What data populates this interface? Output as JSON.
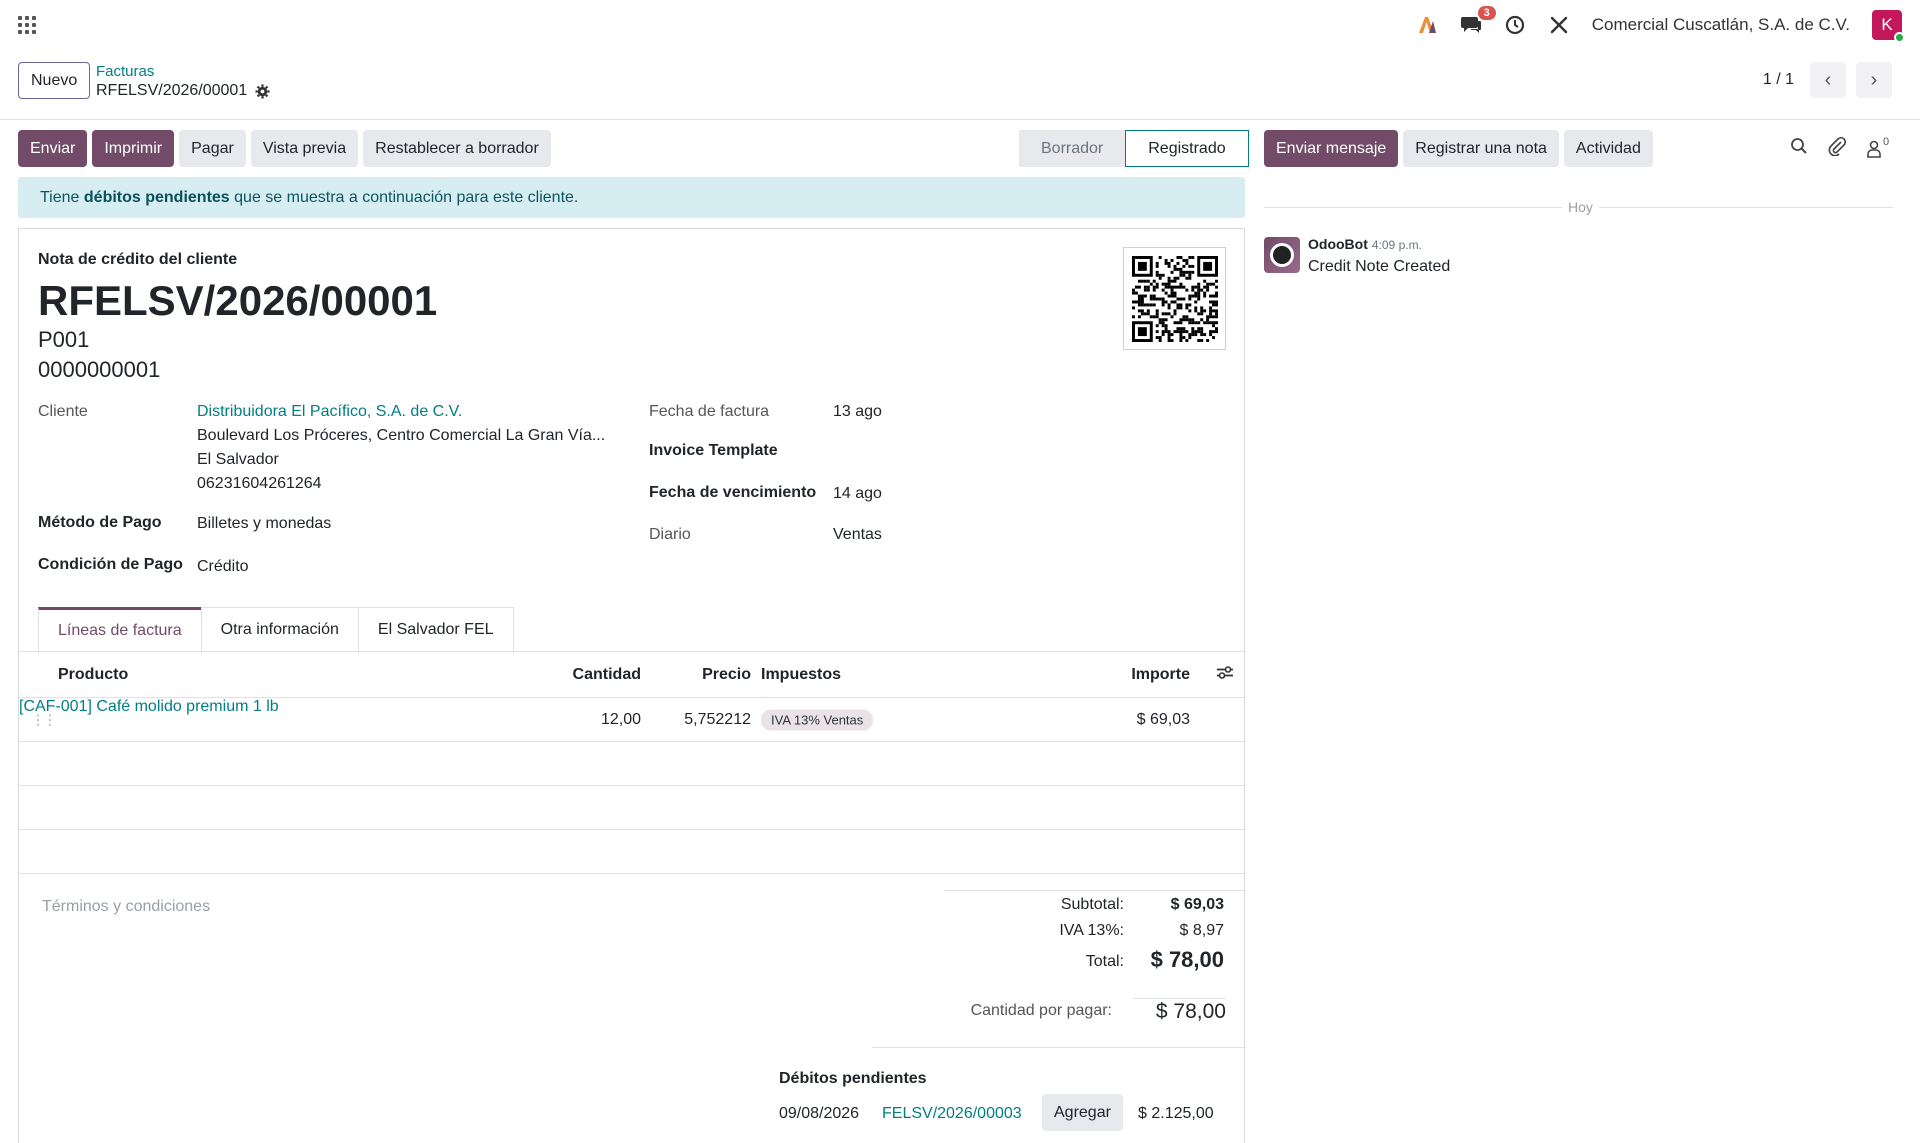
{
  "navbar": {
    "chat_badge": "3",
    "company": "Comercial Cuscatlán, S.A. de C.V.",
    "avatar_letter": "K"
  },
  "control": {
    "new_label": "Nuevo",
    "breadcrumb_parent": "Facturas",
    "breadcrumb_current": "RFELSV/2026/00001",
    "pager": "1 / 1"
  },
  "actions": {
    "send": "Enviar",
    "print": "Imprimir",
    "pay": "Pagar",
    "preview": "Vista previa",
    "reset": "Restablecer a borrador"
  },
  "status": {
    "draft": "Borrador",
    "posted": "Registrado"
  },
  "alert": {
    "prefix": "Tiene ",
    "bold": "débitos pendientes",
    "suffix": " que se muestra a continuación para este cliente."
  },
  "document": {
    "type": "Nota de crédito del cliente",
    "name": "RFELSV/2026/00001",
    "line1": "P001",
    "line2": "0000000001"
  },
  "fields": {
    "customer_label": "Cliente",
    "customer_name": "Distribuidora El Pacífico, S.A. de C.V.",
    "customer_address": "Boulevard Los Próceres, Centro Comercial La Gran Vía...",
    "customer_country": "El Salvador",
    "customer_phone": "06231604261264",
    "payment_method_label": "Método de Pago",
    "payment_method": "Billetes y monedas",
    "payment_condition_label": "Condición de Pago",
    "payment_condition": "Crédito",
    "invoice_date_label": "Fecha de factura",
    "invoice_date": "13 ago",
    "template_label": "Invoice Template",
    "due_date_label": "Fecha de vencimiento",
    "due_date": "14 ago",
    "journal_label": "Diario",
    "journal": "Ventas"
  },
  "tabs": [
    {
      "label": "Líneas de factura"
    },
    {
      "label": "Otra información"
    },
    {
      "label": "El Salvador FEL"
    }
  ],
  "table": {
    "headers": {
      "product": "Producto",
      "quantity": "Cantidad",
      "price": "Precio",
      "taxes": "Impuestos",
      "amount": "Importe"
    },
    "rows": [
      {
        "product": "[CAF-001] Café molido premium 1 lb",
        "quantity": "12,00",
        "price": "5,752212",
        "tax": "IVA 13% Ventas",
        "amount": "$ 69,03"
      }
    ]
  },
  "terms_placeholder": "Términos y condiciones",
  "totals": {
    "subtotal_label": "Subtotal:",
    "subtotal": "$ 69,03",
    "iva_label": "IVA 13%:",
    "iva": "$ 8,97",
    "total_label": "Total:",
    "total": "$ 78,00",
    "due_label": "Cantidad por pagar:",
    "due": "$ 78,00"
  },
  "pending": {
    "title": "Débitos pendientes",
    "date": "09/08/2026",
    "ref": "FELSV/2026/00003",
    "add_label": "Agregar",
    "amount": "$ 2.125,00"
  },
  "chatter": {
    "send_message": "Enviar mensaje",
    "log_note": "Registrar una nota",
    "activity": "Actividad",
    "followers_count": "0",
    "today": "Hoy",
    "author": "OdooBot",
    "time": "4:09 p.m.",
    "message": "Credit Note Created"
  }
}
